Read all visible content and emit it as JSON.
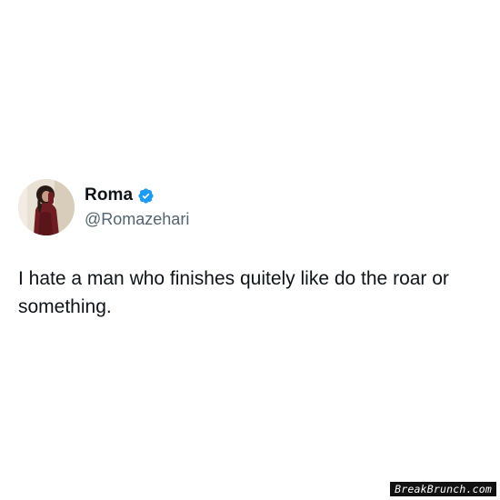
{
  "tweet": {
    "author": {
      "display_name": "Roma",
      "handle": "@Romazehari",
      "verified": true,
      "avatar_icon": "profile-photo",
      "verified_icon": "verified-badge-icon",
      "verified_color": "#1d9bf0"
    },
    "text": "I hate a man who finishes quitely like do the roar or something."
  },
  "watermark": {
    "text": "BreakBrunch.com"
  }
}
